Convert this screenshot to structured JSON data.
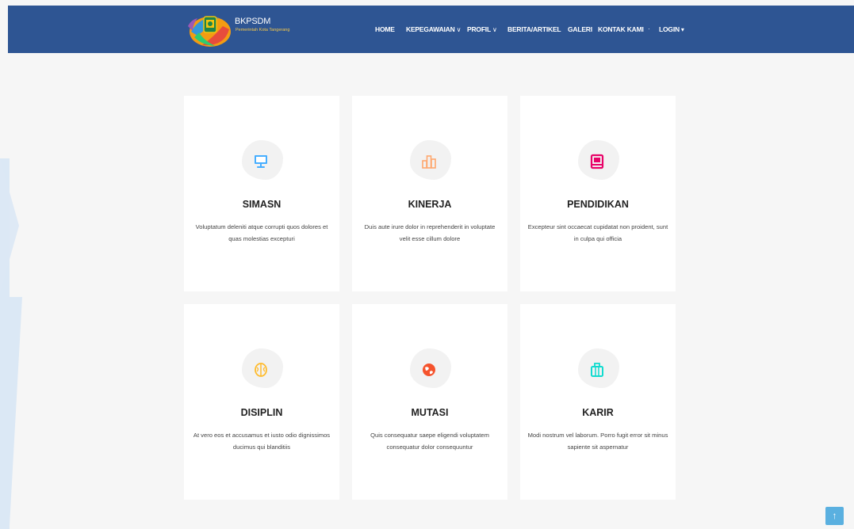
{
  "header": {
    "brand_name": "BKPSDM",
    "brand_sub": "Pemerintah Kota Tangerang",
    "bg_color": "#2e5593"
  },
  "nav": {
    "items": [
      {
        "label": "HOME",
        "dropdown": false
      },
      {
        "label": "KEPEGAWAIAN",
        "dropdown": true
      },
      {
        "label": "PROFIL",
        "dropdown": true
      },
      {
        "label": "BERITA/ARTIKEL",
        "dropdown": false
      },
      {
        "label": "GALERI",
        "dropdown": false
      },
      {
        "label": "KONTAK KAMI",
        "dropdown": false
      }
    ],
    "login": "LOGIN"
  },
  "cards": [
    {
      "title": "SIMASN",
      "desc": "Voluptatum deleniti atque corrupti quos dolores et quas molestias excepturi",
      "icon": "monitor-icon",
      "color": "#47aeff"
    },
    {
      "title": "KINERJA",
      "desc": "Duis aute irure dolor in reprehenderit in voluptate velit esse cillum dolore",
      "icon": "bar-chart-icon",
      "color": "#ffa76e"
    },
    {
      "title": "PENDIDIKAN",
      "desc": "Excepteur sint occaecat cupidatat non proident, sunt in culpa qui officia",
      "icon": "book-icon",
      "color": "#e80368"
    },
    {
      "title": "DISIPLIN",
      "desc": "At vero eos et accusamus et iusto odio dignissimos ducimus qui blanditiis",
      "icon": "brain-icon",
      "color": "#ffbb2c"
    },
    {
      "title": "MUTASI",
      "desc": "Quis consequatur saepe eligendi voluptatem consequatur dolor consequuntur",
      "icon": "globe-icon",
      "color": "#f5532d"
    },
    {
      "title": "KARIR",
      "desc": "Modi nostrum vel laborum. Porro fugit error sit minus sapiente sit aspernatur",
      "icon": "briefcase-icon",
      "color": "#11dbcf"
    }
  ],
  "back_to_top": {
    "icon": "arrow-up-icon",
    "label": "↑"
  }
}
